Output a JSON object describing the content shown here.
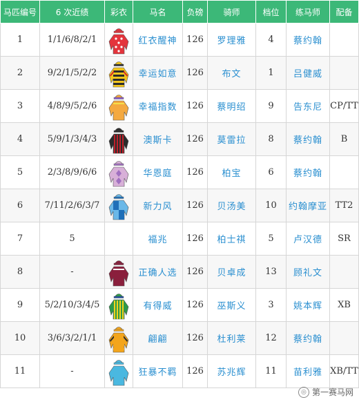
{
  "headers": [
    "马匹编号",
    "6 次近绩",
    "彩衣",
    "马名",
    "负磅",
    "骑师",
    "档位",
    "练马师",
    "配备"
  ],
  "rows": [
    {
      "no": "1",
      "form": "1/1/6/8/2/1",
      "silk": {
        "colors": [
          "#e4343c",
          "#ffffff",
          "#e4343c"
        ],
        "pattern": "dots"
      },
      "name": "红衣醒神",
      "weight": "126",
      "jockey": "罗理雅",
      "draw": "4",
      "trainer": "蔡约翰",
      "gear": ""
    },
    {
      "no": "2",
      "form": "9/2/1/5/2/2",
      "silk": {
        "colors": [
          "#f3c61c",
          "#d42a2a",
          "#2b2b2b"
        ],
        "pattern": "stripes"
      },
      "name": "幸运如意",
      "weight": "126",
      "jockey": "布文",
      "draw": "1",
      "trainer": "吕健威",
      "gear": ""
    },
    {
      "no": "3",
      "form": "4/8/9/5/2/6",
      "silk": {
        "colors": [
          "#f4a940",
          "#f4e04a",
          "#8a5ac8"
        ],
        "pattern": "plain"
      },
      "name": "幸福指数",
      "weight": "126",
      "jockey": "蔡明绍",
      "draw": "9",
      "trainer": "告东尼",
      "gear": "CP/TT"
    },
    {
      "no": "4",
      "form": "5/9/1/3/4/3",
      "silk": {
        "colors": [
          "#2b2b2b",
          "#c0202a",
          "#2b2b2b"
        ],
        "pattern": "vstripes"
      },
      "name": "澳斯卡",
      "weight": "126",
      "jockey": "莫雷拉",
      "draw": "8",
      "trainer": "蔡约翰",
      "gear": "B"
    },
    {
      "no": "5",
      "form": "2/3/8/9/6/6",
      "silk": {
        "colors": [
          "#d8b0d8",
          "#ffffff",
          "#a070c0"
        ],
        "pattern": "diamonds"
      },
      "name": "华恩庭",
      "weight": "126",
      "jockey": "柏宝",
      "draw": "6",
      "trainer": "蔡约翰",
      "gear": ""
    },
    {
      "no": "6",
      "form": "7/11/2/6/3/7",
      "silk": {
        "colors": [
          "#6ab8e8",
          "#ffffff",
          "#1f6fb8"
        ],
        "pattern": "quarters"
      },
      "name": "新力风",
      "weight": "126",
      "jockey": "贝汤美",
      "draw": "10",
      "trainer": "约翰摩亚",
      "gear": "TT2"
    },
    {
      "no": "7",
      "form": "5",
      "silk": null,
      "name": "福兆",
      "weight": "126",
      "jockey": "柏士祺",
      "draw": "5",
      "trainer": "卢汉德",
      "gear": "SR"
    },
    {
      "no": "8",
      "form": "-",
      "silk": {
        "colors": [
          "#8a1f3c",
          "#ffffff",
          "#8a1f3c"
        ],
        "pattern": "plain"
      },
      "name": "正确人选",
      "weight": "126",
      "jockey": "贝卓成",
      "draw": "13",
      "trainer": "顾礼文",
      "gear": ""
    },
    {
      "no": "9",
      "form": "5/2/10/3/4/5",
      "silk": {
        "colors": [
          "#2e9a4a",
          "#f3d21c",
          "#1f4fa0"
        ],
        "pattern": "vstripes"
      },
      "name": "有得威",
      "weight": "126",
      "jockey": "巫斯义",
      "draw": "3",
      "trainer": "姚本辉",
      "gear": "XB"
    },
    {
      "no": "10",
      "form": "3/6/3/2/1/1",
      "silk": {
        "colors": [
          "#f3a51c",
          "#2b2b2b",
          "#f3a51c"
        ],
        "pattern": "stripes"
      },
      "name": "翩翩",
      "weight": "126",
      "jockey": "杜利莱",
      "draw": "12",
      "trainer": "蔡约翰",
      "gear": ""
    },
    {
      "no": "11",
      "form": "-",
      "silk": {
        "colors": [
          "#4ab8e0",
          "#2b2b2b",
          "#4ab8e0"
        ],
        "pattern": "diamonds"
      },
      "name": "狂暴不羁",
      "weight": "126",
      "jockey": "苏兆辉",
      "draw": "11",
      "trainer": "苗利雅",
      "gear": "XB/TT"
    }
  ],
  "watermark": "第一赛马网"
}
